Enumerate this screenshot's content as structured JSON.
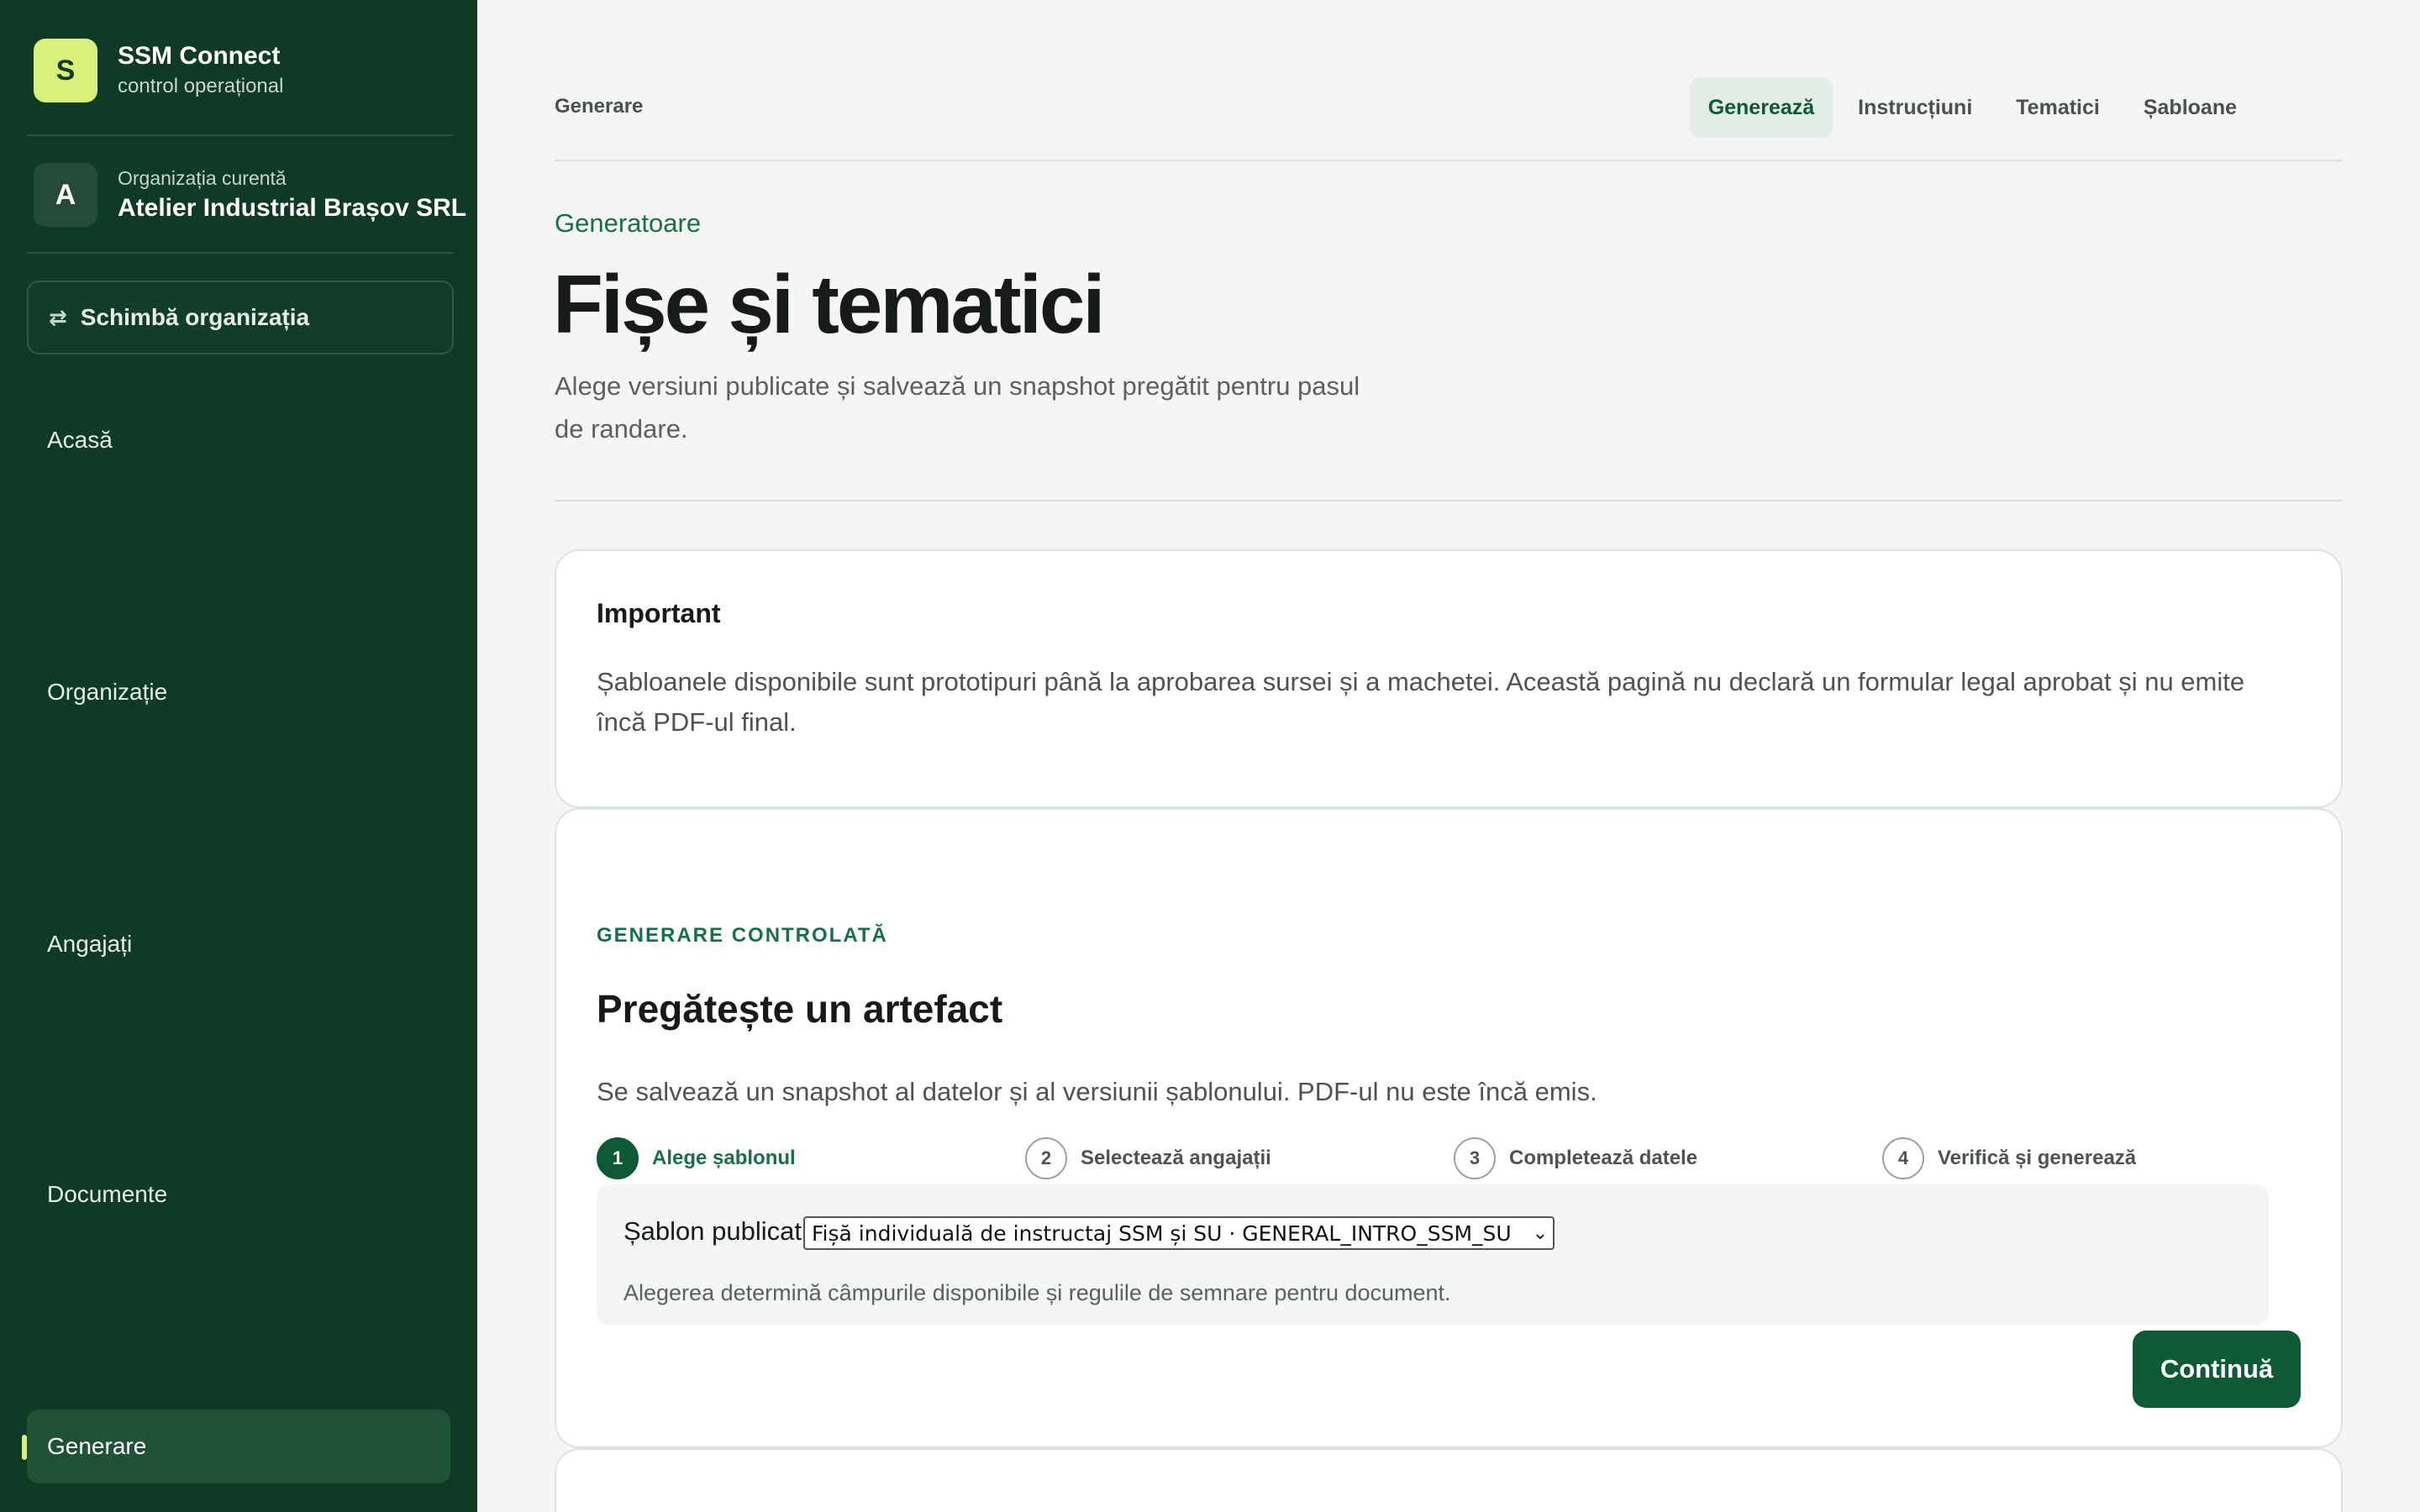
{
  "brand": {
    "logo_letter": "S",
    "name": "SSM Connect",
    "subtitle": "control operațional"
  },
  "organization": {
    "avatar_letter": "A",
    "label": "Organizația curentă",
    "name": "Atelier Industrial Brașov SRL"
  },
  "switch_org": {
    "label": "Schimbă organizația",
    "icon": "swap-arrows-icon"
  },
  "sidebar": {
    "items": [
      {
        "label": "Acasă"
      },
      {
        "label": "Organizație"
      },
      {
        "label": "Angajați"
      },
      {
        "label": "Documente"
      },
      {
        "label": "Generare",
        "active": true
      }
    ]
  },
  "header": {
    "breadcrumb": "Generare",
    "tabs": [
      {
        "label": "Generează",
        "active": true
      },
      {
        "label": "Instrucțiuni"
      },
      {
        "label": "Tematici"
      },
      {
        "label": "Șabloane"
      }
    ]
  },
  "page": {
    "eyebrow": "Generatoare",
    "title": "Fișe și tematici",
    "subtitle": "Alege versiuni publicate și salvează un snapshot pregătit pentru pasul de randare."
  },
  "notice": {
    "title": "Important",
    "text": "Șabloanele disponibile sunt prototipuri până la aprobarea sursei și a machetei. Această pagină nu declară un formular legal aprobat și nu emite încă PDF-ul final."
  },
  "generator": {
    "eyebrow": "GENERARE CONTROLATĂ",
    "title": "Pregătește un artefact",
    "subtitle": "Se salvează un snapshot al datelor și al versiunii șablonului. PDF-ul nu este încă emis.",
    "steps": [
      {
        "num": "1",
        "label": "Alege șablonul",
        "active": true
      },
      {
        "num": "2",
        "label": "Selectează angajații"
      },
      {
        "num": "3",
        "label": "Completează datele"
      },
      {
        "num": "4",
        "label": "Verifică și generează"
      }
    ],
    "field_label": "Șablon publicat",
    "selected_template": "Fișă individuală de instructaj SSM și SU · GENERAL_INTRO_SSM_SU",
    "help_text": "Alegerea determină câmpurile disponibile și regulile de semnare pentru document.",
    "continue_label": "Continuă"
  },
  "colors": {
    "sidebar_bg": "#0f3a26",
    "accent": "#0f5a36",
    "brand_lime": "#d7f17a"
  }
}
